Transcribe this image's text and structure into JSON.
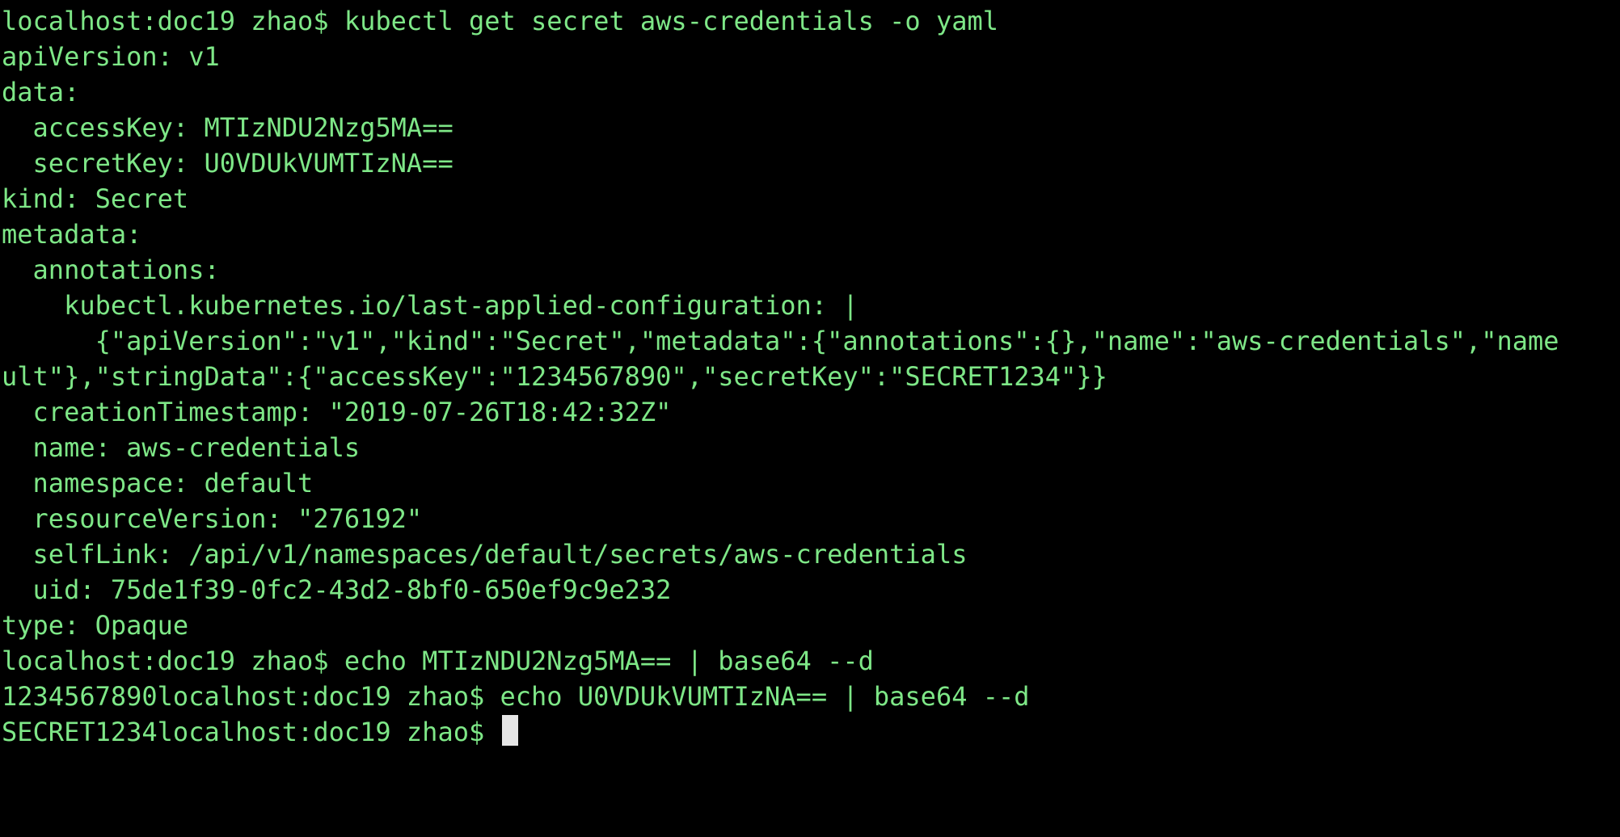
{
  "terminal": {
    "colors": {
      "background": "#000000",
      "text": "#7ee787",
      "cursor": "#e6e6e6"
    },
    "lines": [
      "localhost:doc19 zhao$ kubectl get secret aws-credentials -o yaml",
      "apiVersion: v1",
      "data:",
      "  accessKey: MTIzNDU2Nzg5MA==",
      "  secretKey: U0VDUkVUMTIzNA==",
      "kind: Secret",
      "metadata:",
      "  annotations:",
      "    kubectl.kubernetes.io/last-applied-configuration: |",
      "      {\"apiVersion\":\"v1\",\"kind\":\"Secret\",\"metadata\":{\"annotations\":{},\"name\":\"aws-credentials\",\"name",
      "ult\"},\"stringData\":{\"accessKey\":\"1234567890\",\"secretKey\":\"SECRET1234\"}}",
      "  creationTimestamp: \"2019-07-26T18:42:32Z\"",
      "  name: aws-credentials",
      "  namespace: default",
      "  resourceVersion: \"276192\"",
      "  selfLink: /api/v1/namespaces/default/secrets/aws-credentials",
      "  uid: 75de1f39-0fc2-43d2-8bf0-650ef9c9e232",
      "type: Opaque",
      "localhost:doc19 zhao$ echo MTIzNDU2Nzg5MA== | base64 --d",
      "1234567890localhost:doc19 zhao$ echo U0VDUkVUMTIzNA== | base64 --d",
      "SECRET1234localhost:doc19 zhao$ "
    ]
  }
}
